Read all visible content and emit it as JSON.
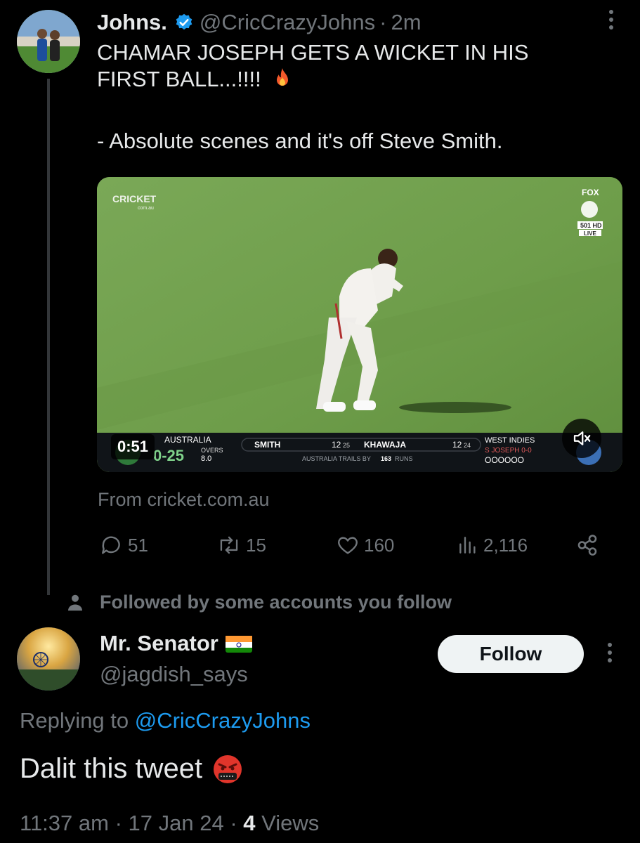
{
  "tweet": {
    "author_name": "Johns.",
    "handle": "@CricCrazyJohns",
    "separator": "·",
    "time": "2m",
    "text_lines": [
      "CHAMAR JOSEPH GETS A WICKET IN HIS",
      "FIRST BALL...!!!!",
      "",
      "- Absolute scenes and it's off Steve Smith."
    ],
    "video": {
      "duration": "0:51",
      "source": "From cricket.com.au",
      "watermark_left": "CRICKET",
      "watermark_left_sub": "com.au",
      "watermark_right_top": "FOX",
      "watermark_right_ch": "501 HD",
      "watermark_right_live": "LIVE",
      "scorebug": {
        "team": "AUSTRALIA",
        "score": "0-25",
        "overs_label": "OVERS",
        "overs": "8.0",
        "batter1": "SMITH",
        "batter1_score": "12",
        "batter1_balls": "25",
        "batter2": "KHAWAJA",
        "batter2_score": "12",
        "batter2_balls": "24",
        "trails": "AUSTRALIA TRAILS BY",
        "trails_runs": "163",
        "trails_unit": "RUNS",
        "bowl_team": "WEST INDIES",
        "bowler": "S JOSEPH 0-0",
        "balls": "OOOOOO"
      }
    },
    "stats": {
      "replies": "51",
      "reposts": "15",
      "likes": "160",
      "views": "2,116"
    }
  },
  "social_context": "Followed by some accounts you follow",
  "reply": {
    "author_name": "Mr. Senator",
    "handle": "@jagdish_says",
    "follow_label": "Follow",
    "replying_prefix": "Replying to",
    "replying_to": "@CricCrazyJohns",
    "text": "Dalit this tweet",
    "time": "11:37 am",
    "date": "17 Jan 24",
    "separator": "·",
    "views_count": "4",
    "views_label": "Views"
  },
  "colors": {
    "background": "#000000",
    "text": "#e7e9ea",
    "secondary": "#71767b",
    "accent": "#1d9bf0",
    "verified": "#1d9bf0"
  }
}
